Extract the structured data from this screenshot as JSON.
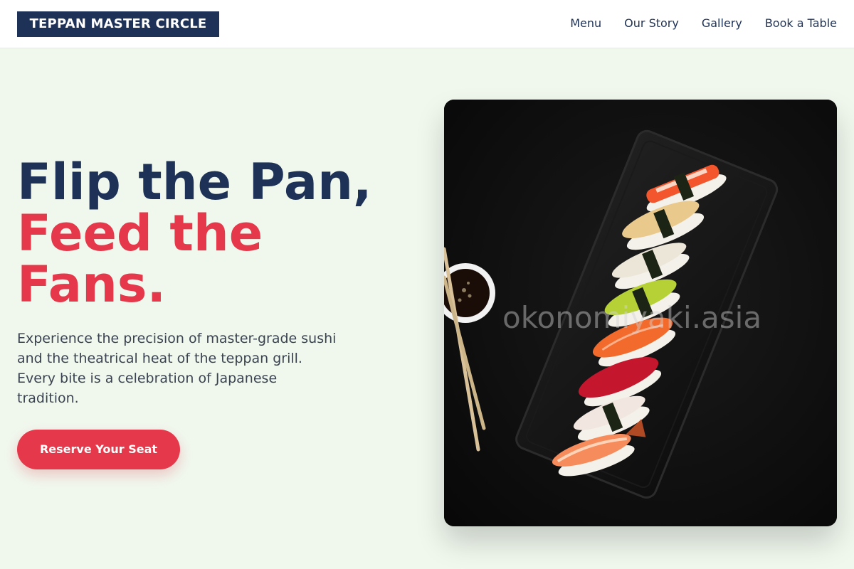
{
  "header": {
    "logo": "TEPPAN MASTER CIRCLE",
    "nav": [
      "Menu",
      "Our Story",
      "Gallery",
      "Book a Table"
    ]
  },
  "hero": {
    "headline_line1": "Flip the Pan,",
    "headline_line2": "Feed the",
    "headline_line3": "Fans.",
    "lead": "Experience the precision of master-grade sushi and the theatrical heat of the teppan grill. Every bite is a celebration of Japanese tradition.",
    "cta_label": "Reserve Your Seat"
  },
  "image": {
    "watermark": "okonomiyaki.asia",
    "subject": "nigiri sushi on black slate plate with soy sauce dish and chopsticks"
  },
  "colors": {
    "navy": "#1e3258",
    "accent_red": "#e5394b",
    "page_bg": "#f0f8ee"
  }
}
